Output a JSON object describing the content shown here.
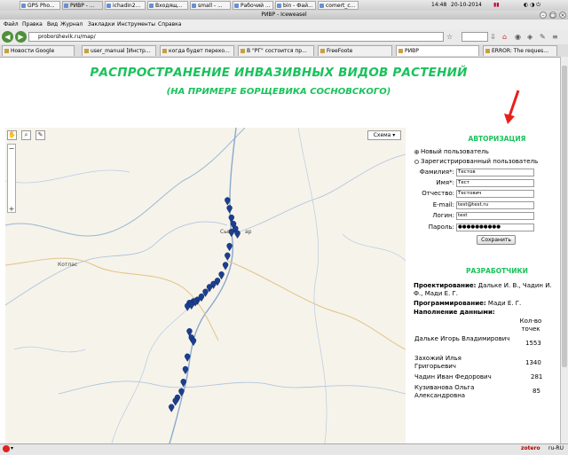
{
  "taskbar": {
    "tasks": [
      "GPS Pho...",
      "РИВР - ...",
      "ichadin2...",
      "Входящ...",
      "small - ...",
      "Рабочий ...",
      "bin - Фай...",
      "comert_c..."
    ],
    "clock": "14:48",
    "date": "20-10-2014"
  },
  "window": {
    "title": "РИВР - Iceweasel"
  },
  "menu": {
    "items": [
      "Файл",
      "Правка",
      "Вид",
      "Журнал",
      "Закладки",
      "Инструменты",
      "Справка"
    ]
  },
  "nav": {
    "url": "proborshevik.ru/map/"
  },
  "tabs": [
    "Новости Google",
    "user_manual [Инстр...",
    "когда будет перехо...",
    "В \"РГ\" состоится пр...",
    "FreeFoote",
    "РИВР",
    "ERROR: The reques..."
  ],
  "page": {
    "title": "РАСПРОСТРАНЕНИЕ ИНВАЗИВНЫХ ВИДОВ РАСТЕНИЙ",
    "subtitle": "(НА ПРИМЕРЕ БОРЩЕВИКА СОСНОВСКОГО)"
  },
  "map": {
    "scheme_label": "Схема ▾",
    "city_label_1": "Сык",
    "city_label_2": "ар",
    "town_label": "Котлас",
    "markers": [
      [
        0.555,
        0.245
      ],
      [
        0.56,
        0.27
      ],
      [
        0.565,
        0.3
      ],
      [
        0.57,
        0.32
      ],
      [
        0.575,
        0.335
      ],
      [
        0.565,
        0.345
      ],
      [
        0.58,
        0.35
      ],
      [
        0.56,
        0.39
      ],
      [
        0.555,
        0.42
      ],
      [
        0.55,
        0.45
      ],
      [
        0.54,
        0.48
      ],
      [
        0.53,
        0.5
      ],
      [
        0.52,
        0.51
      ],
      [
        0.51,
        0.52
      ],
      [
        0.5,
        0.535
      ],
      [
        0.49,
        0.55
      ],
      [
        0.48,
        0.56
      ],
      [
        0.47,
        0.565
      ],
      [
        0.46,
        0.57
      ],
      [
        0.455,
        0.58
      ],
      [
        0.465,
        0.575
      ],
      [
        0.475,
        0.565
      ],
      [
        0.46,
        0.66
      ],
      [
        0.465,
        0.68
      ],
      [
        0.47,
        0.69
      ],
      [
        0.455,
        0.74
      ],
      [
        0.45,
        0.78
      ],
      [
        0.445,
        0.82
      ],
      [
        0.44,
        0.85
      ],
      [
        0.43,
        0.87
      ],
      [
        0.425,
        0.88
      ],
      [
        0.415,
        0.9
      ]
    ]
  },
  "auth": {
    "heading": "АВТОРИЗАЦИЯ",
    "radio_new": "Новый пользователь",
    "radio_registered": "Зарегистрированный пользователь",
    "fields": [
      {
        "label": "Фамилия*:",
        "value": "Тестов"
      },
      {
        "label": "Имя*:",
        "value": "Тест"
      },
      {
        "label": "Отчество:",
        "value": "Тестович"
      },
      {
        "label": "E-mail:",
        "value": "test@test.ru"
      },
      {
        "label": "Логин:",
        "value": "test"
      },
      {
        "label": "Пароль:",
        "value": "●●●●●●●●●●"
      }
    ],
    "save_label": "Сохранить"
  },
  "developers": {
    "heading": "РАЗРАБОТЧИКИ",
    "design_label": "Проектирование:",
    "design_value": "Дальке И. В., Чадин И. Ф., Мади Е. Г.",
    "programming_label": "Программирование:",
    "programming_value": "Мади Е. Г.",
    "filling_label": "Наполнение данными:",
    "count_header": "Кол-во точек",
    "rows": [
      {
        "name": "Дальке Игорь Владимирович",
        "count": "1553"
      },
      {
        "name": "Захожий Илья Григорьевич",
        "count": "1340"
      },
      {
        "name": "Чадин Иван Федорович",
        "count": "281"
      },
      {
        "name": "Кузиванова Ольга Александровна",
        "count": "85"
      }
    ]
  },
  "statusbar": {
    "zotero": "zotero",
    "locale": "ru-RU"
  },
  "colors": {
    "accent": "#19c25b",
    "marker": "#1b3f8f",
    "annotation_arrow": "#e8201a"
  }
}
